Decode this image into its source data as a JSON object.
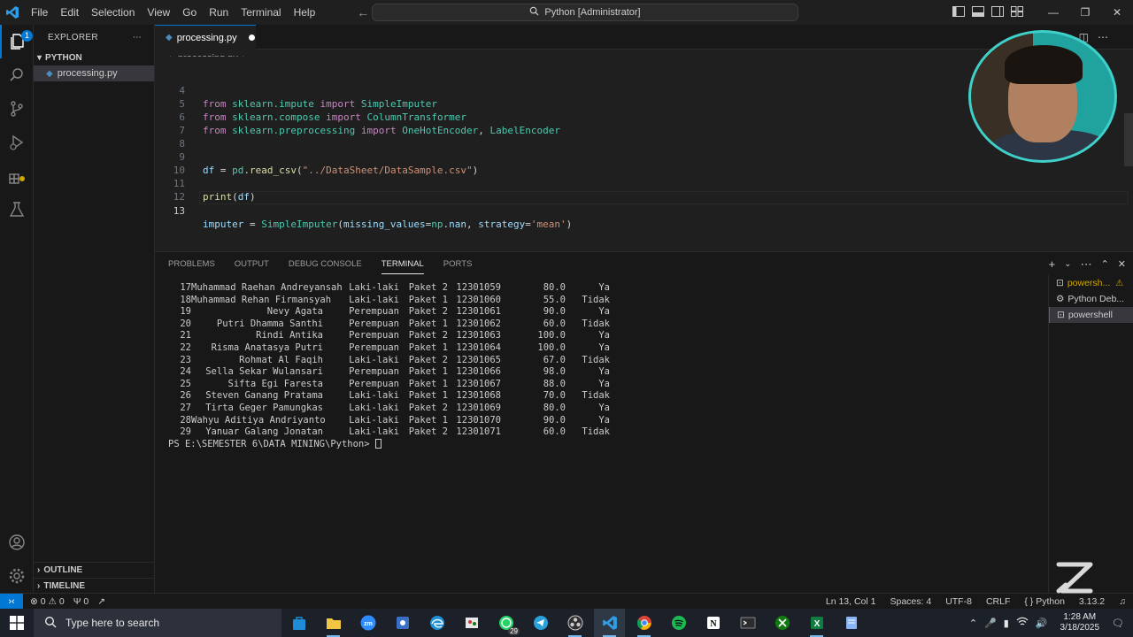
{
  "titlebar": {
    "menu": [
      "File",
      "Edit",
      "Selection",
      "View",
      "Go",
      "Run",
      "Terminal",
      "Help"
    ],
    "command_center": "Python [Administrator]"
  },
  "sidebar": {
    "header": "EXPLORER",
    "folder": "PYTHON",
    "file": "processing.py",
    "outline": "OUTLINE",
    "timeline": "TIMELINE"
  },
  "activity_badge": "1",
  "editor": {
    "tab_label": "processing.py",
    "breadcrumb": [
      "processing.py",
      "..."
    ],
    "lines": [
      {
        "n": "4",
        "code": "from sklearn.impute import SimpleImputer"
      },
      {
        "n": "5",
        "code": "from sklearn.compose import ColumnTransformer"
      },
      {
        "n": "6",
        "code": "from sklearn.preprocessing import OneHotEncoder, LabelEncoder"
      },
      {
        "n": "7",
        "code": ""
      },
      {
        "n": "8",
        "code": ""
      },
      {
        "n": "9",
        "code": "df = pd.read_csv(\"../DataSheet/DataSample.csv\")"
      },
      {
        "n": "10",
        "code": ""
      },
      {
        "n": "11",
        "code": "print(df)"
      },
      {
        "n": "12",
        "code": ""
      },
      {
        "n": "13",
        "code": "imputer = SimpleImputer(missing_values=np.nan, strategy='mean')"
      }
    ],
    "cursor_position": "Ln 13, Col 1"
  },
  "panel": {
    "tabs": [
      "PROBLEMS",
      "OUTPUT",
      "DEBUG CONSOLE",
      "TERMINAL",
      "PORTS"
    ],
    "active_tab": "TERMINAL",
    "terminal_rows": [
      [
        "17",
        "Muhammad Raehan Andreyansah",
        "Laki-laki",
        "Paket 2",
        "12301059",
        "80.0",
        "Ya"
      ],
      [
        "18",
        "Muhammad Rehan Firmansyah",
        "Laki-laki",
        "Paket 1",
        "12301060",
        "55.0",
        "Tidak"
      ],
      [
        "19",
        "Nevy Agata",
        "Perempuan",
        "Paket 2",
        "12301061",
        "90.0",
        "Ya"
      ],
      [
        "20",
        "Putri Dhamma Santhi",
        "Perempuan",
        "Paket 1",
        "12301062",
        "60.0",
        "Tidak"
      ],
      [
        "21",
        "Rindi Antika",
        "Perempuan",
        "Paket 2",
        "12301063",
        "100.0",
        "Ya"
      ],
      [
        "22",
        "Risma Anatasya Putri",
        "Perempuan",
        "Paket 1",
        "12301064",
        "100.0",
        "Ya"
      ],
      [
        "23",
        "Rohmat Al Faqih",
        "Laki-laki",
        "Paket 2",
        "12301065",
        "67.0",
        "Tidak"
      ],
      [
        "24",
        "Sella Sekar Wulansari",
        "Perempuan",
        "Paket 1",
        "12301066",
        "98.0",
        "Ya"
      ],
      [
        "25",
        "Sifta Egi Faresta",
        "Perempuan",
        "Paket 1",
        "12301067",
        "88.0",
        "Ya"
      ],
      [
        "26",
        "Steven Ganang Pratama",
        "Laki-laki",
        "Paket 1",
        "12301068",
        "70.0",
        "Tidak"
      ],
      [
        "27",
        "Tirta Geger Pamungkas",
        "Laki-laki",
        "Paket 2",
        "12301069",
        "80.0",
        "Ya"
      ],
      [
        "28",
        "Wahyu Aditiya Andriyanto",
        "Laki-laki",
        "Paket 1",
        "12301070",
        "90.0",
        "Ya"
      ],
      [
        "29",
        "Yanuar Galang Jonatan",
        "Laki-laki",
        "Paket 2",
        "12301071",
        "60.0",
        "Tidak"
      ]
    ],
    "prompt": "PS E:\\SEMESTER 6\\DATA MINING\\Python> ",
    "terminals": [
      "powersh...",
      "Python Deb...",
      "powershell"
    ]
  },
  "statusbar": {
    "errors": "0",
    "warnings": "0",
    "ports": "0",
    "cursor": "Ln 13, Col 1",
    "spaces": "Spaces: 4",
    "encoding": "UTF-8",
    "eol": "CRLF",
    "language": "Python",
    "version": "3.13.2"
  },
  "taskbar": {
    "search_placeholder": "Type here to search",
    "time": "1:28 AM",
    "date": "3/18/2025",
    "whatsapp_badge": "29"
  }
}
